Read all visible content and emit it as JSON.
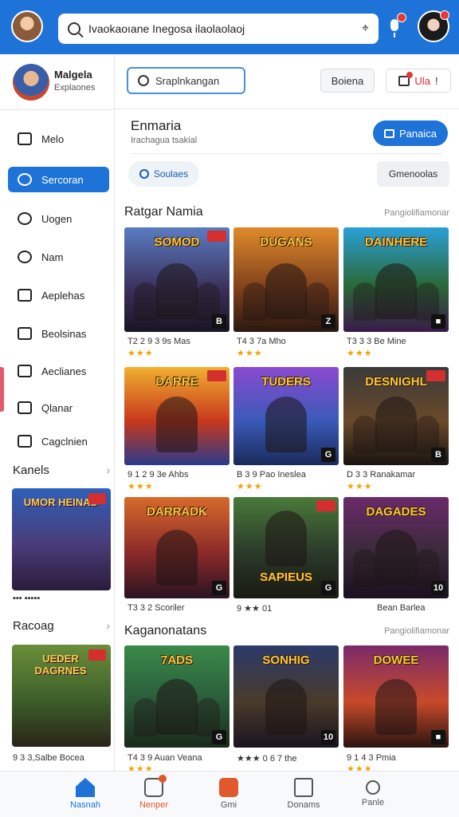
{
  "topbar": {
    "search_text": "Ivaokaoıane  Inegosa ilaolaolaoj"
  },
  "sidebar": {
    "profile": {
      "name": "Malgela",
      "subtitle": "Explaones"
    },
    "items": [
      {
        "label": "Melo",
        "icon": "folder-icon"
      },
      {
        "label": "Sercoran",
        "icon": "search-icon",
        "active": true
      },
      {
        "label": "Uogen",
        "icon": "gamepad-icon"
      },
      {
        "label": "Nam",
        "icon": "chat-icon"
      },
      {
        "label": "Aeplehas",
        "icon": "edit-icon"
      },
      {
        "label": "Beolsinas",
        "icon": "calendar-icon"
      },
      {
        "label": "Aeclianes",
        "icon": "square-icon"
      },
      {
        "label": "Qlanar",
        "icon": "pen-icon"
      },
      {
        "label": "Cagclnien",
        "icon": "code-icon"
      }
    ],
    "section1": {
      "title": "Kanels",
      "card_title": "UMOR HEINAS",
      "meta": "▪▪▪ ▪▪▪▪▪"
    },
    "section2": {
      "title": "Racoag",
      "card_title": "UEDER DAGRNES",
      "meta": "9 3 3,Salbe Bocea"
    }
  },
  "main": {
    "search_placeholder": "Sraplnkangan",
    "btn_ghost": "Boiena",
    "btn_alert_label": "Ula",
    "btn_alert_mark": "!",
    "title": "Enmaria",
    "subtitle": "Irachagua tsakial",
    "primary_button": "Panaica",
    "pill_left": "Soulaes",
    "pill_right": "Gmenoolas",
    "section1": {
      "title": "Ratgar Namia",
      "link": "Pangiolifiamonar"
    },
    "section2": {
      "title": "Kaganonatans",
      "link": "Pangiolifiamonar"
    },
    "grid1": [
      {
        "title": "SOMOD",
        "meta": "T2 2 9 3 9s Mas",
        "stars": "★★★",
        "corner": "B"
      },
      {
        "title": "DUGANS",
        "meta": "T4 3 7a Mho",
        "stars": "★★★",
        "corner": "Z"
      },
      {
        "title": "DAINHERE",
        "meta": "T3 3 3 Be Mine",
        "stars": "★★★",
        "corner": "■"
      },
      {
        "title": "DARRE",
        "meta": "9 1 2 9 3e Ahbs",
        "stars": "★★★",
        "corner": ""
      },
      {
        "title": "TUDERS",
        "meta": "B 3 9 Pao Ineslea",
        "stars": "★★★",
        "corner": "G"
      },
      {
        "title": "DESNIGHL",
        "meta": "D 3 3 Ranakamar",
        "stars": "★★★",
        "corner": "B"
      },
      {
        "title": "DARRADK",
        "meta": "T3 3 2 Scoriler",
        "stars": "",
        "corner": "G"
      },
      {
        "title": "SAPIEUS",
        "meta": "9 ★★ 01",
        "stars": "",
        "corner": "G"
      },
      {
        "title": "DAGADES",
        "meta": "Bean Barlea",
        "stars": "",
        "corner": "10"
      }
    ],
    "grid2": [
      {
        "title": "7ADS",
        "meta": "T4 3 9 Auan Veana",
        "stars": "★★★",
        "corner": "G"
      },
      {
        "title": "SONHIG",
        "meta": "★★★ 0 6 7 the",
        "stars": "",
        "corner": "10"
      },
      {
        "title": "DOWEE",
        "meta": "9 1 4 3 Pmia",
        "stars": "★★★",
        "corner": "■"
      }
    ]
  },
  "bottom_nav": [
    {
      "label": "Nasnah",
      "icon": "home-icon",
      "state": "active"
    },
    {
      "label": "Nenper",
      "icon": "store-icon",
      "state": "red"
    },
    {
      "label": "Gmi",
      "icon": "play-icon",
      "state": ""
    },
    {
      "label": "Donams",
      "icon": "document-icon",
      "state": ""
    },
    {
      "label": "Panle",
      "icon": "search-icon",
      "state": ""
    }
  ],
  "colors": {
    "accent": "#1e73d8",
    "alert": "#d32f2f",
    "gold": "#f6c943"
  }
}
